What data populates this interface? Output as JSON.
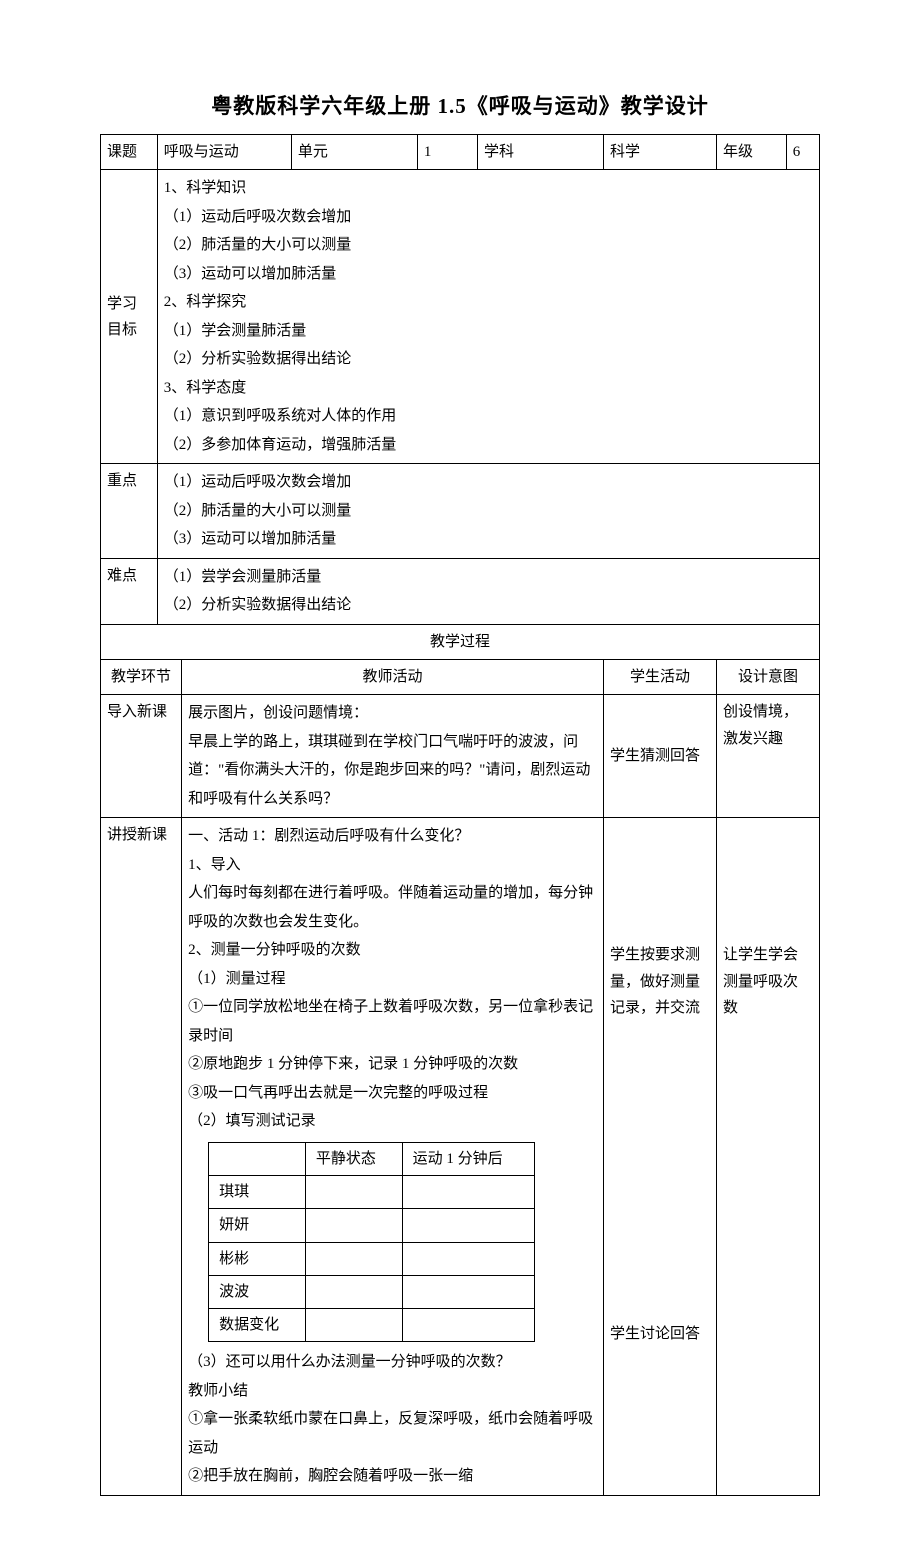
{
  "title": "粤教版科学六年级上册 1.5《呼吸与运动》教学设计",
  "headerRow": {
    "topicLabel": "课题",
    "topicValue": "呼吸与运动",
    "unitLabel": "单元",
    "unitValue": "1",
    "subjectLabel": "学科",
    "subjectValue": "科学",
    "gradeLabel": "年级",
    "gradeValue": "6"
  },
  "goals": {
    "label": "学习\n目标",
    "text": "1、科学知识\n（1）运动后呼吸次数会增加\n（2）肺活量的大小可以测量\n（3）运动可以增加肺活量\n2、科学探究\n（1）学会测量肺活量\n（2）分析实验数据得出结论\n3、科学态度\n（1）意识到呼吸系统对人体的作用\n（2）多参加体育运动，增强肺活量"
  },
  "keypoints": {
    "label": "重点",
    "text": "（1）运动后呼吸次数会增加\n（2）肺活量的大小可以测量\n（3）运动可以增加肺活量"
  },
  "difficulties": {
    "label": "难点",
    "text": "（1）尝学会测量肺活量\n（2）分析实验数据得出结论"
  },
  "processHeader": "教学过程",
  "columnHeaders": {
    "env": "教学环节",
    "teacher": "教师活动",
    "student": "学生活动",
    "intent": "设计意图"
  },
  "introRow": {
    "env": "导入新课",
    "teacher": "展示图片，创设问题情境：\n早晨上学的路上，琪琪碰到在学校门口气喘吁吁的波波，问道：\"看你满头大汗的，你是跑步回来的吗？\"请问，剧烈运动和呼吸有什么关系吗？",
    "student": "学生猜测回答",
    "intent": "创设情境，激发兴趣"
  },
  "mainRow": {
    "env": "讲授新课",
    "teacherPart1": "一、活动 1：剧烈运动后呼吸有什么变化？\n1、导入\n人们每时每刻都在进行着呼吸。伴随着运动量的增加，每分钟呼吸的次数也会发生变化。\n2、测量一分钟呼吸的次数\n（1）测量过程\n①一位同学放松地坐在椅子上数着呼吸次数，另一位拿秒表记录时间\n②原地跑步 1 分钟停下来，记录 1 分钟呼吸的次数\n③吸一口气再呼出去就是一次完整的呼吸过程\n（2）填写测试记录",
    "recordTable": {
      "headers": [
        "",
        "平静状态",
        "运动 1 分钟后"
      ],
      "rows": [
        "琪琪",
        "妍妍",
        "彬彬",
        "波波",
        "数据变化"
      ]
    },
    "teacherPart2": "（3）还可以用什么办法测量一分钟呼吸的次数？\n教师小结\n①拿一张柔软纸巾蒙在口鼻上，反复深呼吸，纸巾会随着呼吸运动\n②把手放在胸前，胸腔会随着呼吸一张一缩",
    "student1": "学生按要求测量，做好测量记录，并交流",
    "student2": "学生讨论回答",
    "intent": "让学生学会测量呼吸次数"
  }
}
